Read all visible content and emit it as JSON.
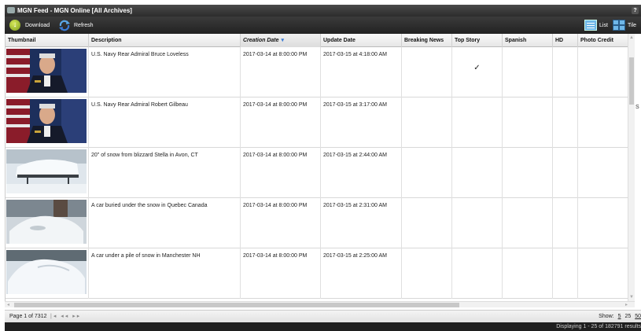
{
  "window": {
    "title": "MGN Feed - MGN Online [All Archives]",
    "help": "?"
  },
  "toolbar": {
    "download_label": "Download",
    "refresh_label": "Refresh",
    "list_label": "List",
    "tile_label": "Tile"
  },
  "columns": [
    "Thumbnail",
    "Description",
    "Creation Date",
    "Update Date",
    "Breaking News",
    "Top Story",
    "Spanish",
    "HD",
    "Photo Credit"
  ],
  "sorted_column": "Creation Date",
  "rows": [
    {
      "description": "U.S. Navy Rear Admiral Bruce Loveless",
      "creation": "2017-03-14 at 8:00:00 PM",
      "update": "2017-03-15 at 4:18:00 AM",
      "top_story": "✓",
      "thumb": "admiral-portrait"
    },
    {
      "description": "U.S. Navy Rear Admiral Robert Gilbeau",
      "creation": "2017-03-14 at 8:00:00 PM",
      "update": "2017-03-15 at 3:17:00 AM",
      "top_story": "",
      "thumb": "admiral-portrait"
    },
    {
      "description": "20\" of snow from blizzard Stella in Avon, CT",
      "creation": "2017-03-14 at 8:00:00 PM",
      "update": "2017-03-15 at 2:44:00 AM",
      "top_story": "",
      "thumb": "snow-table"
    },
    {
      "description": "A car buried under the snow in Quebec Canada",
      "creation": "2017-03-14 at 8:00:00 PM",
      "update": "2017-03-15 at 2:31:00 AM",
      "top_story": "",
      "thumb": "snow-car"
    },
    {
      "description": "A car under a pile of snow in Manchester NH",
      "creation": "2017-03-14 at 8:00:00 PM",
      "update": "2017-03-15 at 2:25:00 AM",
      "top_story": "",
      "thumb": "snow-pile"
    }
  ],
  "footer": {
    "page": "Page 1 of 7312",
    "show_label": "Show:",
    "show_options": [
      "5",
      "25",
      "50"
    ]
  },
  "status": "Displaying 1 - 25 of 182791 results",
  "side_text": "S"
}
